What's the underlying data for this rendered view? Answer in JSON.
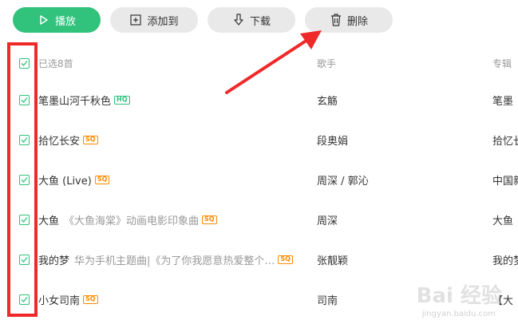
{
  "toolbar": {
    "play_label": "播放",
    "add_label": "添加到",
    "download_label": "下载",
    "delete_label": "删除"
  },
  "header": {
    "selected": "已选8首",
    "singer": "歌手",
    "album": "专辑"
  },
  "rows": [
    {
      "title": "笔墨山河千秋色",
      "sub": "",
      "badge": "HQ",
      "singer": "玄觞",
      "album": "笔墨"
    },
    {
      "title": "拾忆长安",
      "sub": "",
      "badge": "SQ",
      "singer": "段奥娟",
      "album": "拾忆长"
    },
    {
      "title": "大鱼 (Live)",
      "sub": "",
      "badge": "SQ",
      "singer": "周深 / 郭沁",
      "album": "中国新"
    },
    {
      "title": "大鱼",
      "sub": "《大鱼海棠》动画电影印象曲",
      "badge": "SQ",
      "singer": "周深",
      "album": "大鱼"
    },
    {
      "title": "我的梦",
      "sub": "华为手机主题曲|《为了你我愿意热爱整个…",
      "badge": "SQ",
      "singer": "张靓颖",
      "album": "我的梦"
    },
    {
      "title": "小女司南",
      "sub": "",
      "badge": "SQ",
      "singer": "司南",
      "album": "【大"
    }
  ],
  "watermark": {
    "logo": "Bai 经验",
    "url": "jingyan.baidu.com"
  },
  "colors": {
    "accent": "#31c27c",
    "annotation": "#ef2929",
    "sq_badge": "#ff8a00"
  },
  "icons": {
    "play": "play-icon",
    "add": "plus-square-icon",
    "download": "download-icon",
    "delete": "trash-icon",
    "check": "checkmark-icon"
  }
}
